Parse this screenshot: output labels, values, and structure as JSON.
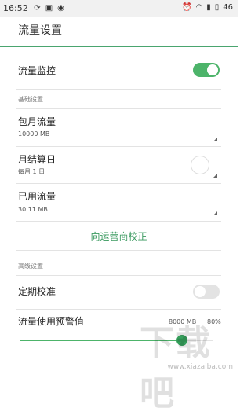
{
  "status_bar": {
    "time": "16:52",
    "left_icons": [
      "sync-icon",
      "image-icon",
      "notification-icon"
    ],
    "right_icons": [
      "alarm-icon",
      "wifi-icon",
      "signal-icon",
      "battery-icon"
    ],
    "battery": "46"
  },
  "header": {
    "title": "流量设置"
  },
  "monitor": {
    "label": "流量监控",
    "enabled": true
  },
  "basic_section": {
    "title": "基础设置",
    "monthly": {
      "label": "包月流量",
      "value": "10000 MB"
    },
    "billing_day": {
      "label": "月结算日",
      "value": "每月 1 日"
    },
    "used": {
      "label": "已用流量",
      "value": "30.11 MB"
    },
    "calibrate_link": "向运营商校正"
  },
  "advanced_section": {
    "title": "高级设置",
    "scheduled": {
      "label": "定期校准",
      "enabled": false
    },
    "warning": {
      "label": "流量使用预警值",
      "amount": "8000 MB",
      "percent": "80%",
      "slider_fraction": 0.8
    }
  },
  "watermark": {
    "text": "www.xiazaiba.com",
    "logo": "下载吧"
  },
  "colors": {
    "accent": "#4db46a",
    "link": "#3a9a5f"
  }
}
